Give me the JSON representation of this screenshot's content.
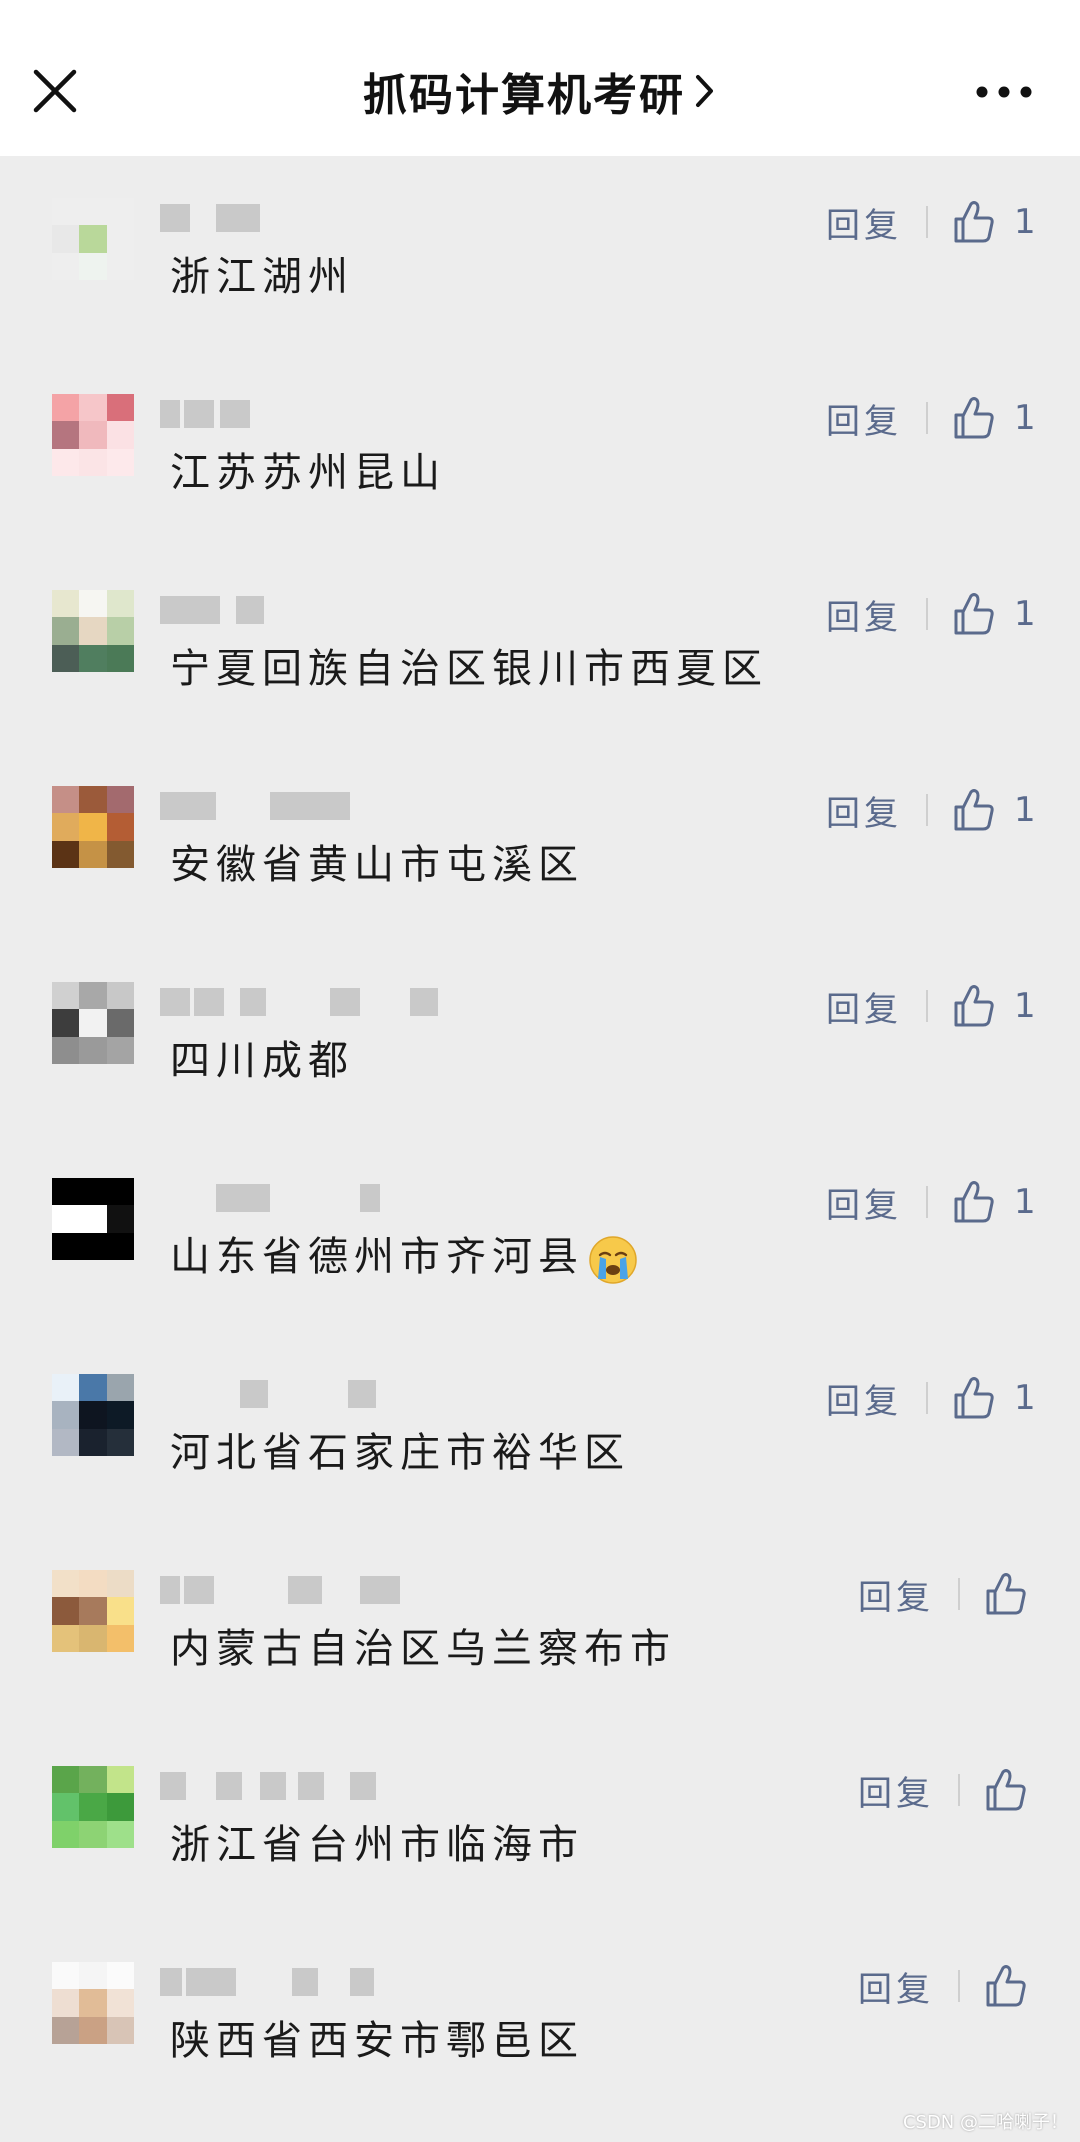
{
  "header": {
    "title": "抓码计算机考研",
    "title_chevron": "chevron-right-icon",
    "close_icon": "close-icon",
    "more_icon": "more-dots-icon"
  },
  "comments": [
    {
      "text": "浙江湖州",
      "reply": "回复",
      "likes": "1"
    },
    {
      "text": "江苏苏州昆山",
      "reply": "回复",
      "likes": "1"
    },
    {
      "text": "宁夏回族自治区银川市西夏区",
      "reply": "回复",
      "likes": "1"
    },
    {
      "text": "安徽省黄山市屯溪区",
      "reply": "回复",
      "likes": "1"
    },
    {
      "text": "四川成都",
      "reply": "回复",
      "likes": "1"
    },
    {
      "text": "山东省德州市齐河县",
      "reply": "回复",
      "likes": "1",
      "emoji": "crying-face-emoji"
    },
    {
      "text": "河北省石家庄市裕华区",
      "reply": "回复",
      "likes": "1"
    },
    {
      "text": "内蒙古自治区乌兰察布市",
      "reply": "回复",
      "likes": ""
    },
    {
      "text": "浙江省台州市临海市",
      "reply": "回复",
      "likes": ""
    },
    {
      "text": "陕西省西安市鄠邑区",
      "reply": "回复",
      "likes": ""
    }
  ],
  "watermark": "CSDN @二哈喇子！",
  "colors": {
    "background": "#ededed",
    "header_bg": "#ffffff",
    "action_text": "#5a6a8c"
  }
}
